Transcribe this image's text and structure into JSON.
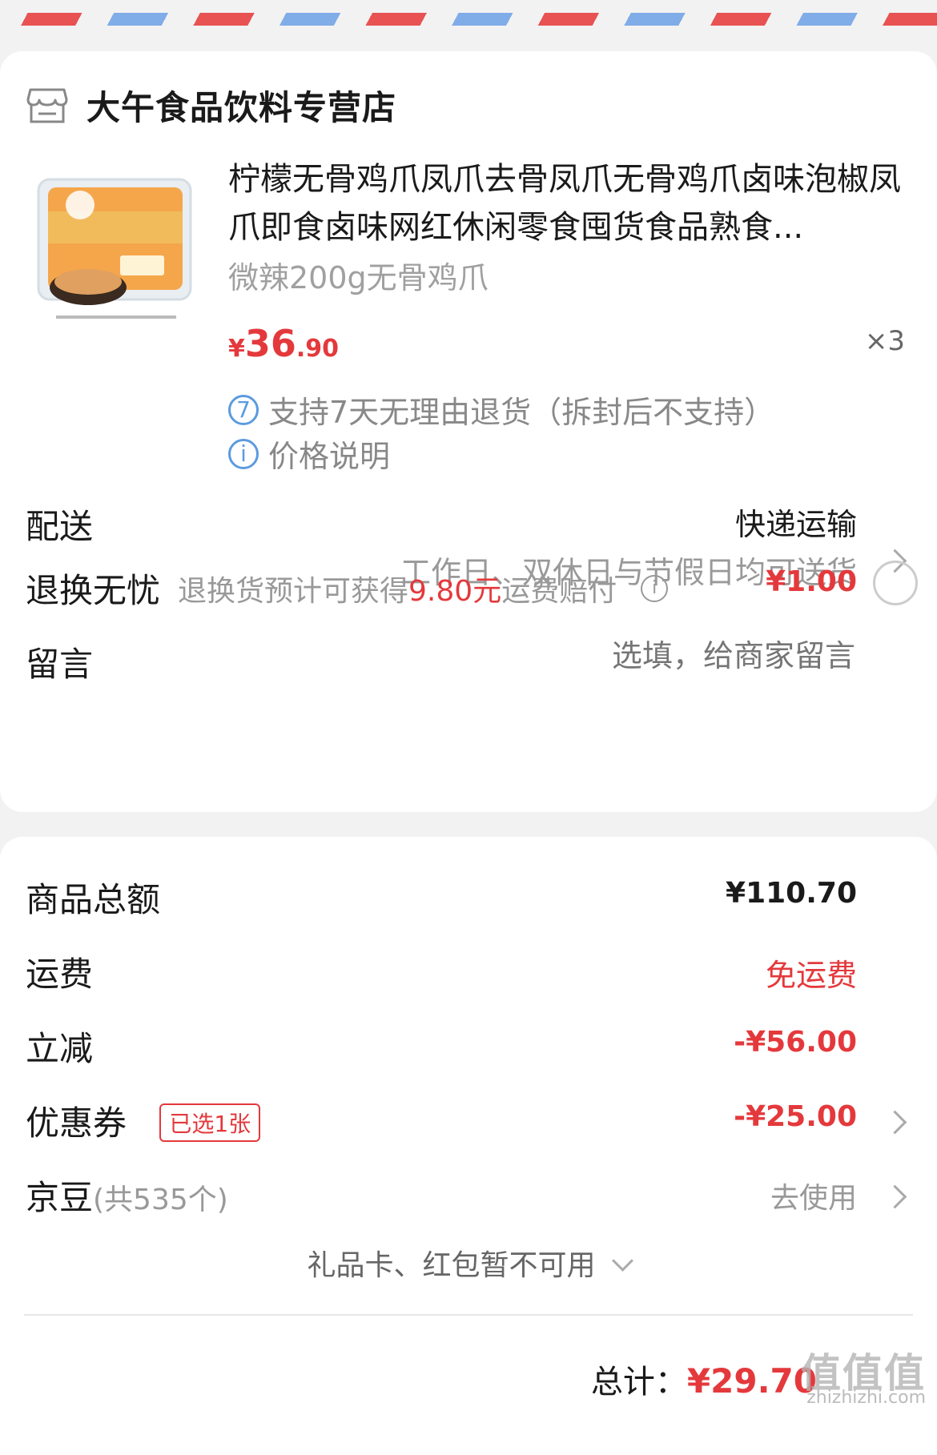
{
  "store": {
    "name": "大午食品饮料专营店",
    "icon": "store-icon"
  },
  "product": {
    "title": "柠檬无骨鸡爪凤爪去骨凤爪无骨鸡爪卤味泡椒凤爪即食卤味网红休闲零食囤货食品熟食...",
    "spec": "微辣200g无骨鸡爪",
    "price_symbol": "¥",
    "price_int": "36",
    "price_dec": ".90",
    "qty": "×3",
    "return_policy_icon": "7",
    "return_policy": "支持7天无理由退货（拆封后不支持）",
    "price_note_icon": "i",
    "price_note": "价格说明"
  },
  "delivery": {
    "label": "配送",
    "method": "快递运输",
    "detail": "工作日、双休日与节假日均可送货"
  },
  "worry_free": {
    "label": "退换无忧",
    "desc_prefix": "退换货预计可获得",
    "desc_amount": "9.80元",
    "desc_suffix": "运费赔付",
    "price": "¥1.00"
  },
  "message": {
    "label": "留言",
    "placeholder": "选填，给商家留言"
  },
  "summary": {
    "goods_total_label": "商品总额",
    "goods_total": "¥110.70",
    "shipping_label": "运费",
    "shipping": "免运费",
    "discount_label": "立减",
    "discount": "-¥56.00",
    "coupon_label": "优惠券",
    "coupon_badge": "已选1张",
    "coupon": "-¥25.00",
    "jingdou_label": "京豆",
    "jingdou_count": "(共535个)",
    "jingdou_action": "去使用",
    "unavailable": "礼品卡、红包暂不可用",
    "total_label": "总计：",
    "total": "¥29.70"
  },
  "watermark": {
    "main": "值值值",
    "sub": "zhizhizhi.com"
  },
  "colors": {
    "accent": "#e4393c",
    "info_blue": "#5b9be0"
  }
}
